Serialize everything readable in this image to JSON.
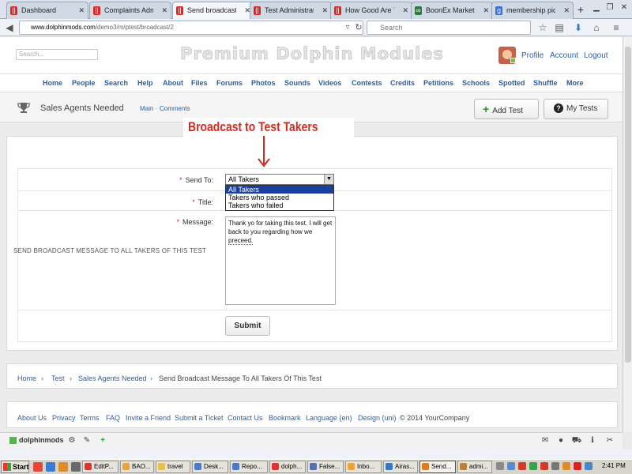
{
  "browser": {
    "tabs": [
      {
        "title": "Dashboard",
        "favicon": "dolphin-icon",
        "color": "#d22"
      },
      {
        "title": "Complaints Admi...",
        "favicon": "dolphin-icon",
        "color": "#d22"
      },
      {
        "title": "Send broadcast ...",
        "favicon": "dolphin-icon",
        "color": "#d22",
        "active": true
      },
      {
        "title": "Test Administrat...",
        "favicon": "dolphin-icon",
        "color": "#d22"
      },
      {
        "title": "How Good Are Y...",
        "favicon": "dolphin-icon",
        "color": "#d22"
      },
      {
        "title": "BoonEx Market - ...",
        "favicon": "boonex-icon",
        "color": "#2a7a3b"
      },
      {
        "title": "membership pics ...",
        "favicon": "google-icon",
        "color": "#3b6fd8"
      }
    ],
    "url_domain": "www.dolphinmods.com",
    "url_path": "/demo3/m/ptest/broadcast/2",
    "search_placeholder": "Search"
  },
  "site": {
    "search_placeholder": "Search...",
    "title": "Premium Dolphin Modules",
    "top_links": [
      "Profile",
      "Account",
      "Logout"
    ],
    "nav": [
      "Home",
      "People",
      "Search",
      "Help",
      "About",
      "Files",
      "Forums",
      "Photos",
      "Sounds",
      "Videos",
      "Contests",
      "Credits",
      "Petitions",
      "Schools",
      "Spotted",
      "Shuffle",
      "More"
    ]
  },
  "page": {
    "title": "Sales Agents Needed",
    "sublinks": [
      "Main",
      "·",
      "Comments"
    ],
    "buttons": [
      {
        "label": "Add Test",
        "icon": "plus-icon",
        "glyph": "+",
        "color": "#2b8a2b"
      },
      {
        "label": "My Tests",
        "icon": "question-icon",
        "glyph": "?",
        "color": "#222"
      }
    ]
  },
  "annotation": {
    "text": "Broadcast to Test Takers"
  },
  "form": {
    "heading": "SEND BROADCAST MESSAGE TO ALL TAKERS OF THIS TEST",
    "send_to_label": "Send To:",
    "send_to_value": "All Takers",
    "send_to_options": [
      "All Takers",
      "Takers who passed",
      "Takers who failed"
    ],
    "title_label": "Title:",
    "message_label": "Message:",
    "message_value_before": "Thank yo for taking this test. I will get back to you regarding how we ",
    "message_value_misspelled": "preceed.",
    "submit_label": "Submit"
  },
  "breadcrumb": [
    "Home",
    "Test",
    "Sales Agents Needed",
    "Send Broadcast Message To All Takers Of This Test"
  ],
  "footer": {
    "links": [
      "About Us",
      "Privacy",
      "Terms",
      "FAQ",
      "Invite a Friend",
      "Submit a Ticket",
      "Contact Us",
      "Bookmark",
      "Language (en)",
      "Design (uni)"
    ],
    "copyright": "© 2014 YourCompany"
  },
  "dolphin_bar": {
    "name": "dolphinmods"
  },
  "taskbar": {
    "start": "Start",
    "tasks": [
      {
        "label": "EditP...",
        "color": "#d33"
      },
      {
        "label": "BAO...",
        "color": "#e8a33b"
      },
      {
        "label": "travel",
        "color": "#e6c24c"
      },
      {
        "label": "Desk...",
        "color": "#4d7ac6"
      },
      {
        "label": "Repo...",
        "color": "#4d7ac6"
      },
      {
        "label": "dolph...",
        "color": "#d33"
      },
      {
        "label": "False...",
        "color": "#5a6fb0"
      },
      {
        "label": "Inbo...",
        "color": "#e8a33b"
      },
      {
        "label": "Airas...",
        "color": "#3a77c2"
      },
      {
        "label": "Send...",
        "color": "#e07a20",
        "active": true
      },
      {
        "label": "admi...",
        "color": "#b5843a"
      }
    ],
    "clock": "2:41 PM"
  }
}
